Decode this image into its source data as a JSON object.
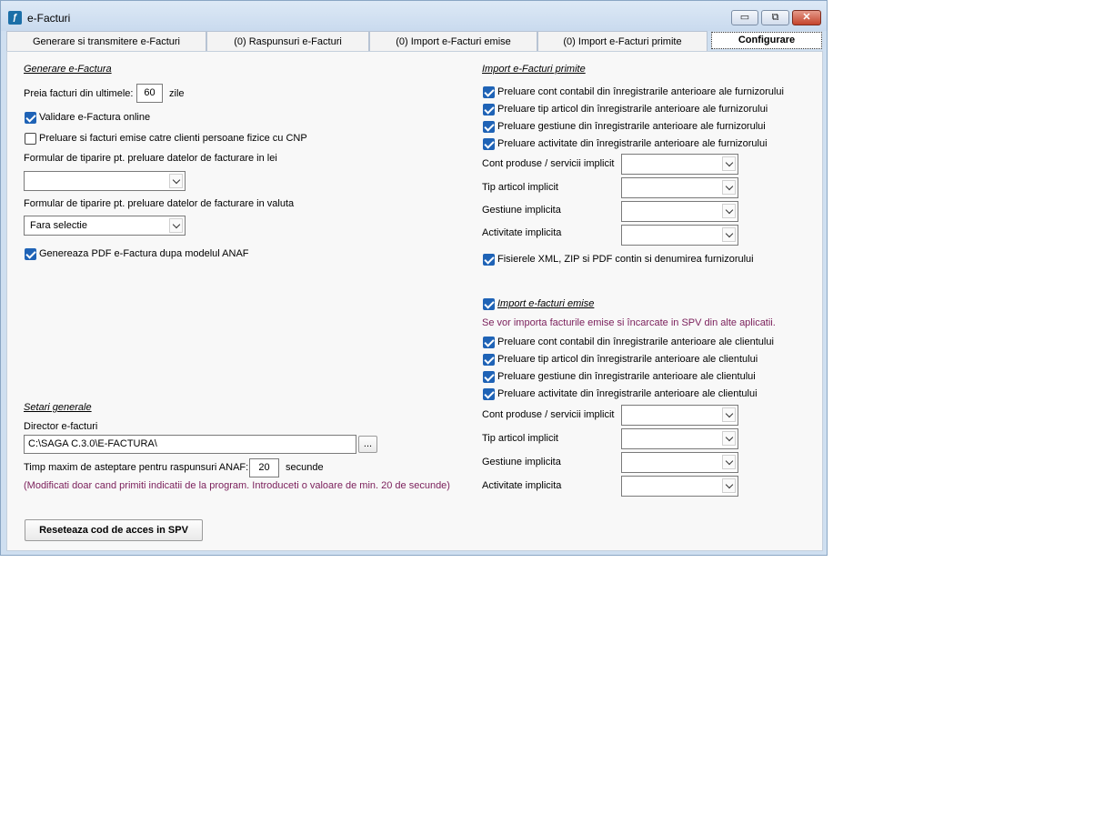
{
  "window": {
    "title": "e-Facturi",
    "icon": "app-icon"
  },
  "tabs": [
    {
      "label": "Generare si transmitere e-Facturi"
    },
    {
      "label": "(0) Raspunsuri e-Facturi"
    },
    {
      "label": "(0) Import e-Facturi emise"
    },
    {
      "label": "(0) Import e-Facturi primite"
    },
    {
      "label": "Configurare"
    }
  ],
  "generare": {
    "title": "Generare e-Factura",
    "preia_label": "Preia facturi din ultimele:",
    "preia_value": "60",
    "preia_unit": "zile",
    "validare_label": "Validare e-Factura online",
    "validare_checked": true,
    "preluare_cnp_label": "Preluare si facturi emise catre clienti persoane fizice cu CNP",
    "preluare_cnp_checked": false,
    "formular_lei_label": "Formular de tiparire pt. preluare datelor de facturare in lei",
    "formular_lei_value": "",
    "formular_valuta_label": "Formular de tiparire pt. preluare datelor de facturare in valuta",
    "formular_valuta_value": "Fara selectie",
    "pdf_label": "Genereaza PDF e-Factura dupa modelul ANAF",
    "pdf_checked": true
  },
  "setari": {
    "title": "Setari generale",
    "director_label": "Director e-facturi",
    "director_value": "C:\\SAGA C.3.0\\E-FACTURA\\",
    "browse_label": "...",
    "timp_label": "Timp  maxim de asteptare pentru raspunsuri ANAF:",
    "timp_value": "20",
    "timp_unit": "secunde",
    "note": "(Modificati doar cand primiti indicatii de la program. Introduceti o valoare de min. 20 de secunde)",
    "reset_label": "Reseteaza cod de acces in SPV"
  },
  "import_primite": {
    "title": "Import e-Facturi primite",
    "options": [
      {
        "label": "Preluare cont contabil din înregistrarile anterioare ale furnizorului",
        "checked": true
      },
      {
        "label": "Preluare tip articol din înregistrarile anterioare ale furnizorului",
        "checked": true
      },
      {
        "label": "Preluare gestiune din înregistrarile anterioare ale furnizorului",
        "checked": true
      },
      {
        "label": "Preluare activitate din înregistrarile anterioare ale furnizorului",
        "checked": true
      }
    ],
    "fields": [
      {
        "label": "Cont produse / servicii implicit",
        "value": ""
      },
      {
        "label": "Tip articol implicit",
        "value": ""
      },
      {
        "label": "Gestiune implicita",
        "value": ""
      },
      {
        "label": "Activitate implicita",
        "value": ""
      }
    ],
    "xml_label": "Fisierele XML, ZIP si PDF contin si denumirea furnizorului",
    "xml_checked": true
  },
  "import_emise": {
    "title": "Import e-facturi emise ",
    "enabled": true,
    "note": "Se vor importa facturile emise si încarcate in SPV din alte aplicatii.",
    "options": [
      {
        "label": "Preluare cont contabil din înregistrarile anterioare ale clientului",
        "checked": true
      },
      {
        "label": "Preluare tip articol din înregistrarile anterioare ale clientului",
        "checked": true
      },
      {
        "label": "Preluare gestiune din înregistrarile anterioare ale clientului",
        "checked": true
      },
      {
        "label": "Preluare activitate din înregistrarile anterioare ale clientului",
        "checked": true
      }
    ],
    "fields": [
      {
        "label": "Cont produse / servicii implicit",
        "value": ""
      },
      {
        "label": "Tip articol implicit",
        "value": ""
      },
      {
        "label": "Gestiune implicita",
        "value": ""
      },
      {
        "label": "Activitate implicita",
        "value": ""
      }
    ]
  },
  "colors": {
    "accent": "#1f63b6",
    "note_text": "#7a1e5a",
    "close_button": "#c4442c"
  }
}
